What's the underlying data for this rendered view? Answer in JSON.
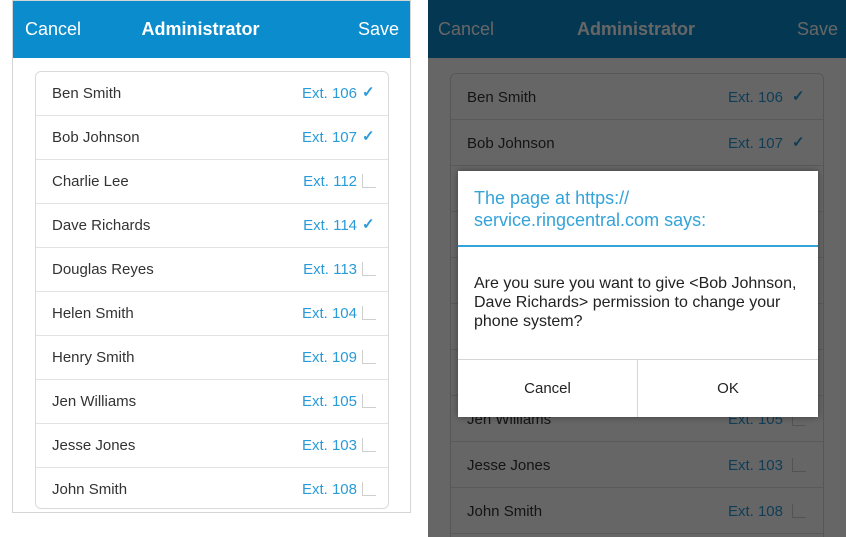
{
  "header": {
    "cancel_label": "Cancel",
    "title": "Administrator",
    "save_label": "Save"
  },
  "users": [
    {
      "name": "Ben Smith",
      "ext": "Ext. 106",
      "checked": true
    },
    {
      "name": "Bob Johnson",
      "ext": "Ext. 107",
      "checked": true
    },
    {
      "name": "Charlie Lee",
      "ext": "Ext. 112",
      "checked": false
    },
    {
      "name": "Dave Richards",
      "ext": "Ext. 114",
      "checked": true
    },
    {
      "name": "Douglas Reyes",
      "ext": "Ext. 113",
      "checked": false
    },
    {
      "name": "Helen Smith",
      "ext": "Ext. 104",
      "checked": false
    },
    {
      "name": "Henry Smith",
      "ext": "Ext. 109",
      "checked": false
    },
    {
      "name": "Jen Williams",
      "ext": "Ext. 105",
      "checked": false
    },
    {
      "name": "Jesse Jones",
      "ext": "Ext. 103",
      "checked": false
    },
    {
      "name": "John Smith",
      "ext": "Ext. 108",
      "checked": false
    }
  ],
  "dialog": {
    "title": "The page at https:// service.ringcentral.com says:",
    "message": "Are you sure you want to give <Bob Johnson, Dave Richards> permission to change your phone system?",
    "cancel_label": "Cancel",
    "ok_label": "OK"
  },
  "colors": {
    "header_bg": "#0b8ccd",
    "accent": "#2a9bd8",
    "dialog_accent": "#34a3d9"
  },
  "icons": {
    "checked": "checkmark-icon",
    "unchecked": "empty-checkbox-icon"
  }
}
